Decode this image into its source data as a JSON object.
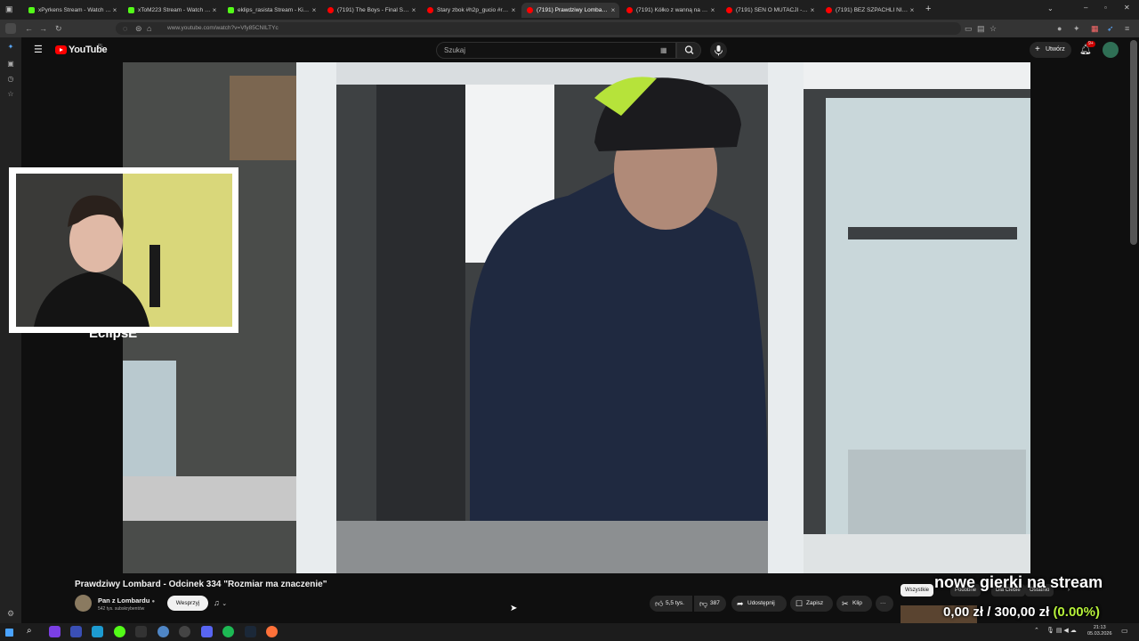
{
  "browser": {
    "tabs": [
      {
        "title": "xPyrkens Stream - Watch Live",
        "color": "#53fc18"
      },
      {
        "title": "xToM223 Stream - Watch Live",
        "color": "#53fc18"
      },
      {
        "title": "eklips_rasista Stream - Kick Dashboard",
        "color": "#53fc18"
      },
      {
        "title": "(7191) The Boys - Final Season",
        "color": "#ff0000"
      },
      {
        "title": "Stary zbok #h2p_gucio #reki",
        "color": "#ff0000"
      },
      {
        "title": "(7191) Prawdziwy Lombard - Odcinek",
        "color": "#ff0000",
        "active": true
      },
      {
        "title": "(7191) Kółko z wanną na płycie",
        "color": "#ff0000"
      },
      {
        "title": "(7191) SEN O MUTACJI - YouTube",
        "color": "#ff0000"
      },
      {
        "title": "(7191) BEZ SZPACHLI NIE DA RADY",
        "color": "#ff0000"
      }
    ],
    "new_tab": "+",
    "url": "www.youtube.com/watch?v=Vfy85CNILTYc"
  },
  "youtube": {
    "logo_text": "YouTube",
    "logo_country": "PL",
    "search_placeholder": "Szukaj",
    "create_label": "Utwórz",
    "notifications_badge": "9+"
  },
  "webcam": {
    "streamer_name": "EclipsE"
  },
  "video": {
    "title": "Prawdziwy Lombard - Odcinek 334 \"Rozmiar ma znaczenie\"",
    "channel_name": "Pan z Lombardu",
    "subscribers": "542 tys. subskrybentów",
    "support_label": "Wesprzyj",
    "likes": "5,5 tys.",
    "dislikes": "387",
    "share_label": "Udostępnij",
    "save_label": "Zapisz",
    "clip_label": "Klip",
    "more_label": "···"
  },
  "recommend_chips": [
    "Wszystkie",
    "Podobne",
    "Dla Ciebie",
    "Ostatnio"
  ],
  "overlays": {
    "stream_message": "nowe gierki na stream",
    "goal_current": "0,00 zł",
    "goal_separator": "/",
    "goal_target": "300,00 zł",
    "goal_percent": "(0.00%)"
  },
  "taskbar": {
    "time": "21:13",
    "date": "05.03.2026"
  },
  "colors": {
    "youtube_red": "#ff0000",
    "kick_green": "#53fc18",
    "goal_green": "#b6f23a"
  }
}
